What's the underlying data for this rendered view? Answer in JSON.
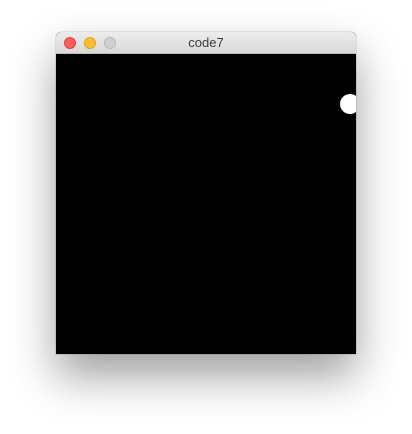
{
  "window": {
    "title": "code7"
  },
  "canvas": {
    "background_color": "#000000",
    "ball_color": "#ffffff"
  },
  "colors": {
    "close": "#fc5f57",
    "minimize": "#fdbc2e",
    "zoom_inactive": "#d0d0d0"
  }
}
